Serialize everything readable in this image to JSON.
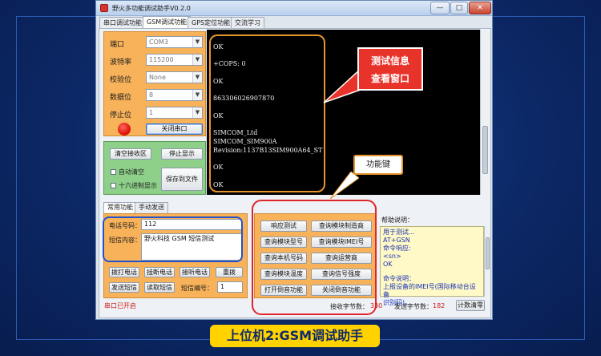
{
  "window": {
    "title": "野火多功能调试助手V0.2.0",
    "controls": [
      "—",
      "□",
      "✕"
    ]
  },
  "tabs": [
    "串口调试功能",
    "GSM调试功能",
    "GPS定位功能",
    "交流学习"
  ],
  "serial": {
    "port_label": "端口",
    "port_value": "COM3",
    "baud_label": "波特率",
    "baud_value": "115200",
    "parity_label": "校验位",
    "parity_value": "None",
    "databits_label": "数据位",
    "databits_value": "8",
    "stopbits_label": "停止位",
    "stopbits_value": "1",
    "close_port": "关闭串口"
  },
  "receive": {
    "clear": "清空接收区",
    "stop_display": "停止显示",
    "auto_clear": "自动清空",
    "hex_display": "十六进制显示",
    "save_file": "保存到文件"
  },
  "terminal": {
    "lines": [
      "OK",
      "+COPS: 0",
      "OK",
      "863306026907870",
      "OK",
      "SIMCOM_Ltd",
      "SIMCOM_SIM900A",
      "Revision:1137B13SIM900A64_ST",
      "OK",
      "OK"
    ]
  },
  "annotations": {
    "test_info": [
      "测试信息",
      "查看窗口"
    ],
    "function_keys": "功能键",
    "banner": "上位机2:GSM调试助手"
  },
  "subtabs": [
    "常用功能",
    "手动发送"
  ],
  "sms": {
    "phone_label": "电话号码：",
    "phone_value": "112",
    "content_label": "短信内容：",
    "content_value": "野火科技 GSM 短信测试"
  },
  "call_buttons": [
    "拨打电话",
    "挂断电话",
    "接听电话",
    "重拨"
  ],
  "sms_buttons": [
    "发送短信",
    "读取短信"
  ],
  "sms_index_label": "短信编号：",
  "sms_index_value": "1",
  "status": "串口已开启",
  "function_buttons": [
    [
      "响应测试",
      "查询模块制造商"
    ],
    [
      "查询模块型号",
      "查询模块IMEI号"
    ],
    [
      "查询本机号码",
      "查询运营商"
    ],
    [
      "查询模块温度",
      "查询信号强度"
    ],
    [
      "打开倒音功能",
      "关闭倒音功能"
    ]
  ],
  "help": {
    "title": "帮助说明：",
    "lines": [
      "用于测试...",
      "AT+GSN",
      "命令响应:",
      "<sn>",
      "OK",
      "",
      "命令说明：",
      "上报设备的IMEI号(国际移动台设备",
      "识别码)。"
    ]
  },
  "counters": {
    "recv_label": "接收字节数：",
    "recv_value": "330",
    "send_label": "发送字节数：",
    "send_value": "182",
    "clear_label": "计数清零"
  },
  "colors": {
    "background": "#0c2866",
    "orange": "#f7b25a",
    "green": "#8ed08a",
    "banner": "#ffd200",
    "callout_red": "#e8332a"
  }
}
